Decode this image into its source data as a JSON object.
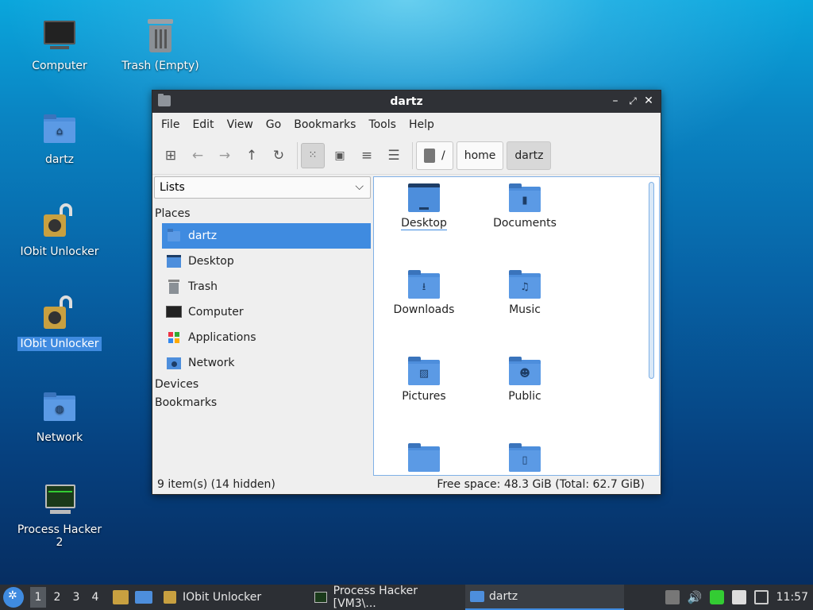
{
  "desktop": {
    "icons": [
      {
        "label": "Computer"
      },
      {
        "label": "Trash (Empty)"
      },
      {
        "label": "dartz"
      },
      {
        "label": "IObit Unlocker"
      },
      {
        "label": "IObit Unlocker"
      },
      {
        "label": "Network"
      },
      {
        "label": "Process Hacker 2"
      }
    ]
  },
  "window": {
    "title": "dartz",
    "controls": {
      "minimize": "–",
      "maximize": "⤢",
      "close": "✕"
    },
    "menu": [
      "File",
      "Edit",
      "View",
      "Go",
      "Bookmarks",
      "Tools",
      "Help"
    ],
    "breadcrumb": {
      "root": "/",
      "parts": [
        "home",
        "dartz"
      ]
    },
    "side_select": "Lists",
    "places_header": "Places",
    "places": [
      {
        "label": "dartz",
        "icon": "home-icon"
      },
      {
        "label": "Desktop",
        "icon": "desktop-icon"
      },
      {
        "label": "Trash",
        "icon": "trash-icon"
      },
      {
        "label": "Computer",
        "icon": "computer-icon"
      },
      {
        "label": "Applications",
        "icon": "applications-icon"
      },
      {
        "label": "Network",
        "icon": "network-icon"
      }
    ],
    "devices_header": "Devices",
    "bookmarks_header": "Bookmarks",
    "files": [
      {
        "label": "Desktop"
      },
      {
        "label": "Documents"
      },
      {
        "label": "Downloads"
      },
      {
        "label": "Music"
      },
      {
        "label": "Pictures"
      },
      {
        "label": "Public"
      },
      {
        "label": ""
      },
      {
        "label": ""
      }
    ],
    "status_left": "9 item(s) (14 hidden)",
    "status_right": "Free space: 48.3 GiB (Total: 62.7 GiB)"
  },
  "taskbar": {
    "workspaces": [
      "1",
      "2",
      "3",
      "4"
    ],
    "tasks": [
      {
        "label": "IObit Unlocker"
      },
      {
        "label": "Process Hacker [VM3\\..."
      },
      {
        "label": "dartz"
      }
    ],
    "clock": "11:57"
  },
  "colors": {
    "accent": "#3f8be0",
    "folder": "#4d8edc",
    "titlebar": "#2f3136"
  }
}
